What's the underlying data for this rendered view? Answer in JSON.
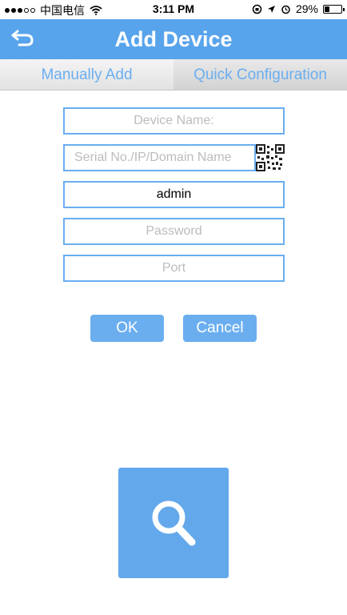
{
  "status_bar": {
    "carrier": "中国电信",
    "time": "3:11 PM",
    "battery_percent": "29%",
    "battery_level": 0.29,
    "signal_filled": 3,
    "signal_total": 5,
    "icons": [
      "wifi-icon",
      "screen-rotation-lock-icon",
      "location-arrow-icon",
      "alarm-icon",
      "battery-icon"
    ]
  },
  "header": {
    "title": "Add Device",
    "back_icon": "back-arrow-icon",
    "background": "#58a4ec"
  },
  "tabs": [
    {
      "label": "Manually Add",
      "active": true
    },
    {
      "label": "Quick Configuration",
      "active": false
    }
  ],
  "form": {
    "device_name": {
      "value": "",
      "placeholder": "Device Name:"
    },
    "address": {
      "value": "",
      "placeholder": "Serial No./IP/Domain Name"
    },
    "username": {
      "value": "admin",
      "placeholder": ""
    },
    "password": {
      "value": "",
      "placeholder": "Password"
    },
    "port": {
      "value": "",
      "placeholder": "Port"
    },
    "qr_icon": "qr-code-icon"
  },
  "buttons": {
    "ok": "OK",
    "cancel": "Cancel"
  },
  "search": {
    "icon": "search-icon"
  },
  "colors": {
    "accent": "#6aaef0",
    "header": "#58a4ec",
    "tile": "#64a8ec"
  }
}
